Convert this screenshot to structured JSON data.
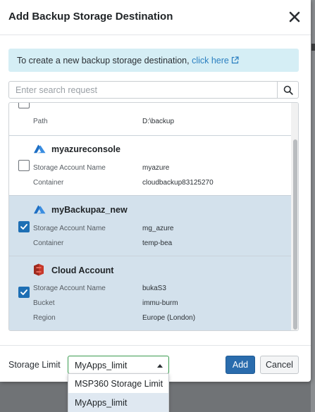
{
  "dialog": {
    "title": "Add Backup Storage Destination"
  },
  "info": {
    "text": "To create a new backup storage destination, ",
    "link_text": "click here"
  },
  "search": {
    "placeholder": "Enter search request",
    "value": ""
  },
  "destinations": [
    {
      "name": "",
      "icon": "hidden-icon",
      "checked": false,
      "properties": [
        {
          "label": "Path",
          "value": "D:\\backup"
        }
      ]
    },
    {
      "name": "myazureconsole",
      "icon": "azure-icon",
      "checked": false,
      "properties": [
        {
          "label": "Storage Account Name",
          "value": "myazure"
        },
        {
          "label": "Container",
          "value": "cloudbackup83125270"
        }
      ]
    },
    {
      "name": "myBackupaz_new",
      "icon": "azure-icon",
      "checked": true,
      "properties": [
        {
          "label": "Storage Account Name",
          "value": "mg_azure"
        },
        {
          "label": "Container",
          "value": "temp-bea"
        }
      ]
    },
    {
      "name": "Cloud Account",
      "icon": "aws-s3-icon",
      "checked": true,
      "properties": [
        {
          "label": "Storage Account Name",
          "value": "bukaS3"
        },
        {
          "label": "Bucket",
          "value": "immu-burm"
        },
        {
          "label": "Region",
          "value": "Europe (London)"
        }
      ]
    }
  ],
  "footer": {
    "storage_limit_label": "Storage Limit",
    "selected_limit": "MyApps_limit",
    "add_label": "Add",
    "cancel_label": "Cancel"
  },
  "limit_options": [
    {
      "label": "MSP360 Storage Limit",
      "active": false
    },
    {
      "label": "MyApps_limit",
      "active": true
    }
  ],
  "colors": {
    "primary": "#2a6cad",
    "selected_row": "#d3e1ec",
    "info_banner": "#d5eef5",
    "link": "#2a7fc0",
    "azure": "#1e6fc4",
    "aws": "#c7382a",
    "select_border": "#3a9b4f"
  }
}
